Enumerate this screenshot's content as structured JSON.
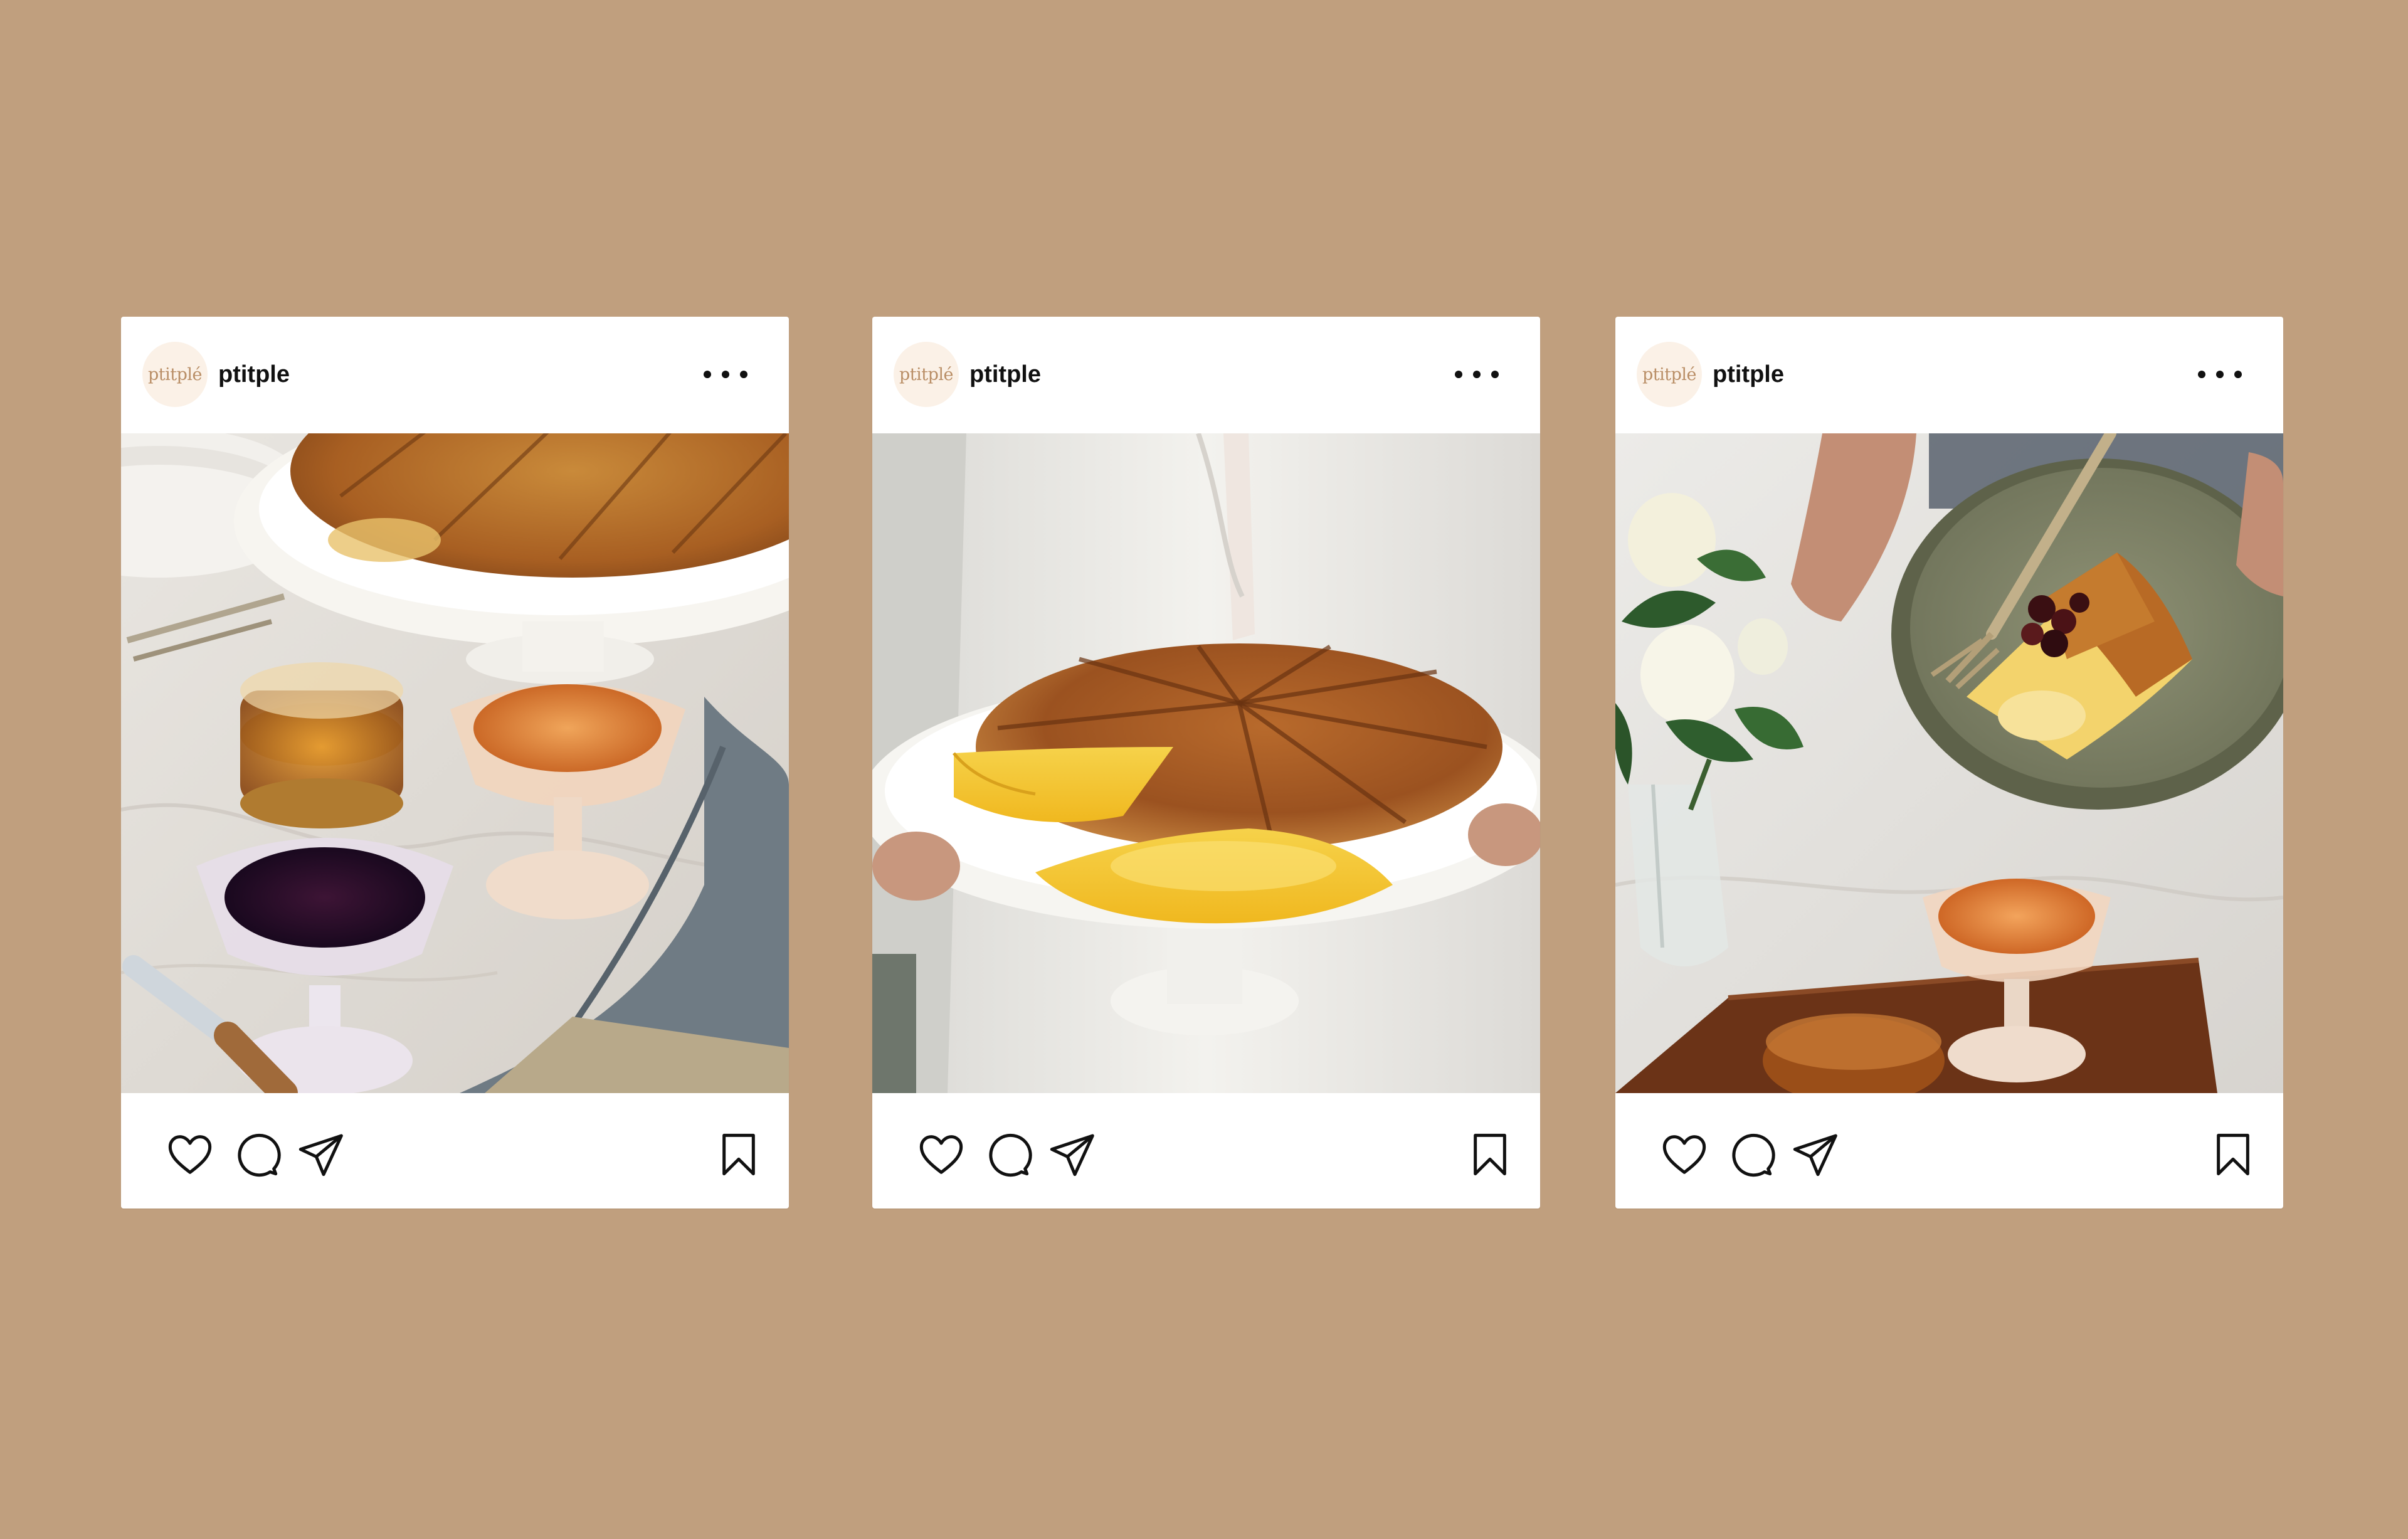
{
  "background_color": "#c09f7e",
  "posts": [
    {
      "username": "ptitple",
      "avatar_text": "ptitplé",
      "avatar_bg": "#fbf1e7",
      "avatar_text_color": "#b98e66",
      "more_icon": "more-horizontal-icon",
      "actions": {
        "like_icon": "heart-icon",
        "comment_icon": "comment-icon",
        "share_icon": "send-icon",
        "save_icon": "bookmark-icon"
      },
      "photo_subject": "galette des rois on a white cake stand with glass bowls of jam and honey"
    },
    {
      "username": "ptitple",
      "avatar_text": "ptitplé",
      "avatar_bg": "#fbf1e7",
      "avatar_text_color": "#b98e66",
      "more_icon": "more-horizontal-icon",
      "actions": {
        "like_icon": "heart-icon",
        "comment_icon": "comment-icon",
        "share_icon": "send-icon",
        "save_icon": "bookmark-icon"
      },
      "photo_subject": "person holding a cut galette with yellow cream filling on a white cake stand"
    },
    {
      "username": "ptitple",
      "avatar_text": "ptitplé",
      "avatar_bg": "#fbf1e7",
      "avatar_text_color": "#b98e66",
      "more_icon": "more-horizontal-icon",
      "actions": {
        "like_icon": "heart-icon",
        "comment_icon": "comment-icon",
        "share_icon": "send-icon",
        "save_icon": "bookmark-icon"
      },
      "photo_subject": "hands holding a green plate with a slice of galette, roses and a jam bowl"
    }
  ]
}
